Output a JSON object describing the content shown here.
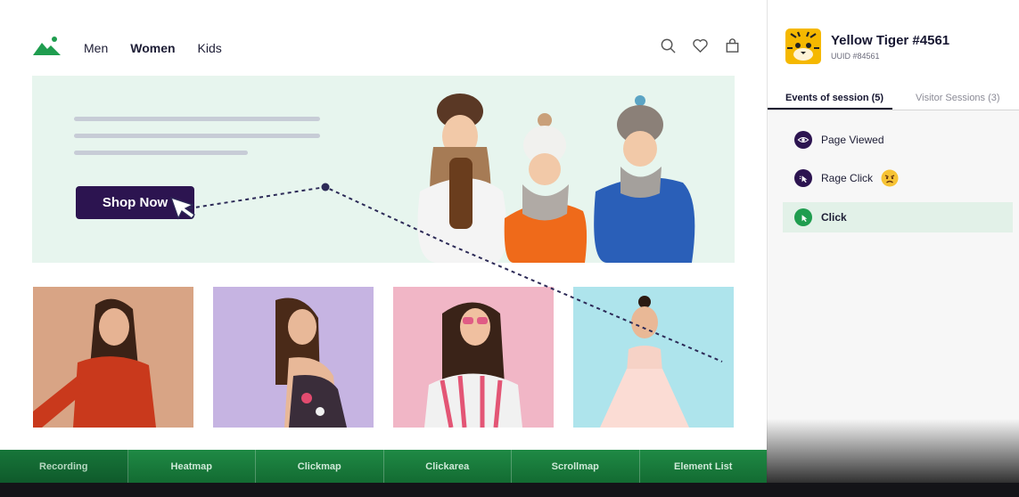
{
  "site": {
    "nav": [
      "Men",
      "Women",
      "Kids"
    ],
    "active_nav": "Women",
    "hero_button": "Shop Now",
    "icons": [
      "search-icon",
      "heart-icon",
      "shopping-bag-icon"
    ]
  },
  "toolbar": {
    "tabs": [
      "Recording",
      "Heatmap",
      "Clickmap",
      "Clickarea",
      "Scrollmap",
      "Element List"
    ]
  },
  "visitor": {
    "name": "Yellow Tiger #4561",
    "uuid": "UUID #84561"
  },
  "panel": {
    "tab_events": "Events of session (5)",
    "tab_sessions": "Visitor Sessions (3)",
    "events": [
      {
        "label": "Page Viewed",
        "icon": "eye-icon",
        "color": "#2c1450"
      },
      {
        "label": "Rage Click",
        "icon": "rage-click-icon",
        "color": "#2c1450"
      },
      {
        "label": "Click",
        "icon": "click-icon",
        "color": "#1f9d4f"
      }
    ]
  },
  "colors": {
    "brand_dark": "#2c1450",
    "accent_green": "#1f9d4f",
    "hero_bg": "#e7f5ee"
  }
}
